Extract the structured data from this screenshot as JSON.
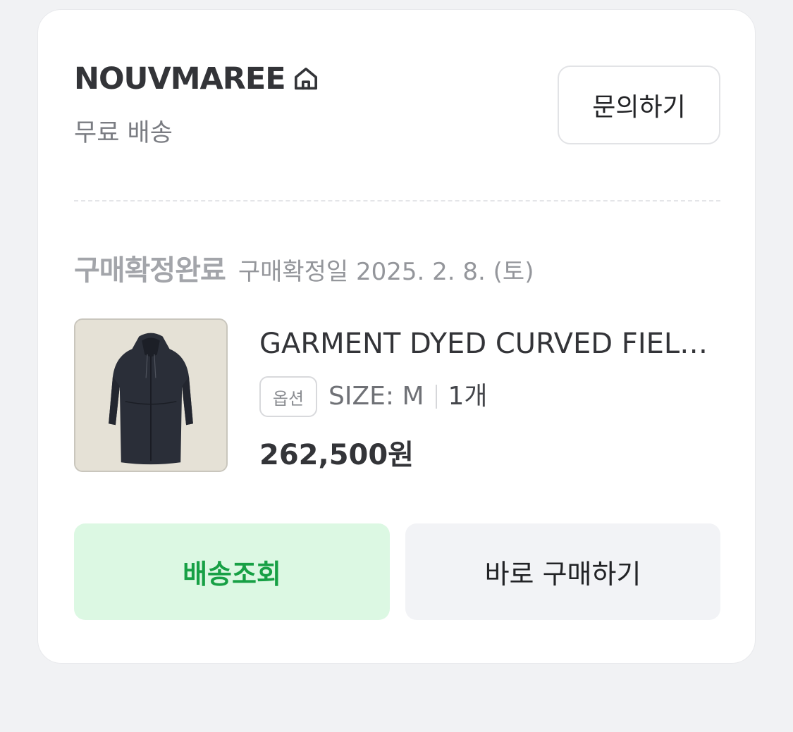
{
  "seller": {
    "name": "NOUVMAREE",
    "shipping": "무료 배송",
    "inquiry_label": "문의하기",
    "icon": "home-icon"
  },
  "order": {
    "status": "구매확정완료",
    "status_date": "구매확정일 2025. 2. 8. (토)"
  },
  "product": {
    "name": "GARMENT DYED CURVED FIELD COAT",
    "option_badge": "옵션",
    "option_value": "SIZE: M",
    "quantity": "1개",
    "price": "262,500원",
    "thumbnail": "navy-coat-image"
  },
  "actions": {
    "track_label": "배송조회",
    "buy_again_label": "바로 구매하기"
  },
  "colors": {
    "accent_green": "#17a045",
    "accent_green_bg": "#dcf8e3",
    "text_dark": "#333438",
    "muted": "#a3a5aa"
  }
}
